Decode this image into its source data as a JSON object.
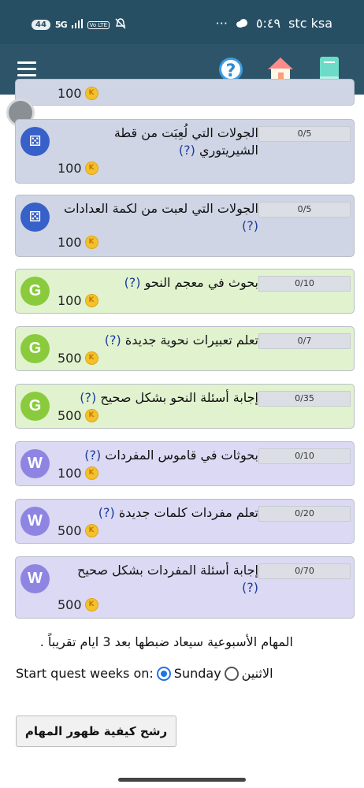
{
  "status_bar": {
    "network_badge": "44",
    "signal": "5G",
    "volte": "Vo LTE",
    "dots": "···",
    "time": "٥:٤٩",
    "carrier": "stc ksa"
  },
  "app_bar": {
    "help_glyph": "?",
    "icons": [
      "menu-icon",
      "help-icon",
      "home-icon",
      "book-icon"
    ]
  },
  "cut_off_reward": "100",
  "coin_letter": "K",
  "quests": [
    {
      "type": "dice",
      "badge": "⚄",
      "title": "الجولات التي لُعِبَت من قطة الشيريتوري",
      "q": "(?)",
      "reward": "100",
      "progress": "0/5"
    },
    {
      "type": "dice",
      "badge": "⚄",
      "title": "الجولات التي لعبت من لكمة العدادات",
      "q": "(?)",
      "reward": "100",
      "progress": "0/5"
    },
    {
      "type": "grammar",
      "badge": "G",
      "title": "بحوث في معجم النحو",
      "q": "(?)",
      "reward": "100",
      "progress": "0/10"
    },
    {
      "type": "grammar",
      "badge": "G",
      "title": "تعلم تعبيرات نحوية جديدة",
      "q": "(?)",
      "reward": "500",
      "progress": "0/7"
    },
    {
      "type": "grammar",
      "badge": "G",
      "title": "إجابة أسئلة النحو بشكل صحيح",
      "q": "(?)",
      "reward": "500",
      "progress": "0/35"
    },
    {
      "type": "vocab",
      "badge": "W",
      "title": "بحوثات في قاموس المفردات",
      "q": "(?)",
      "reward": "100",
      "progress": "0/10"
    },
    {
      "type": "vocab",
      "badge": "W",
      "title": "تعلم مفردات كلمات جديدة",
      "q": "(?)",
      "reward": "500",
      "progress": "0/20"
    },
    {
      "type": "vocab",
      "badge": "W",
      "title": "إجابة أسئلة المفردات بشكل صحيح",
      "q": "(?)",
      "reward": "500",
      "progress": "0/70"
    }
  ],
  "weekly_note": "المهام الأسبوعية سيعاد ضبطها بعد 3 ايام تقريباً .",
  "start_week": {
    "label": "Start quest weeks on:",
    "option_sunday": "Sunday",
    "option_monday": "الاثنين",
    "selected": "Sunday"
  },
  "filter_button": "رشح كيفية ظهور المهام"
}
